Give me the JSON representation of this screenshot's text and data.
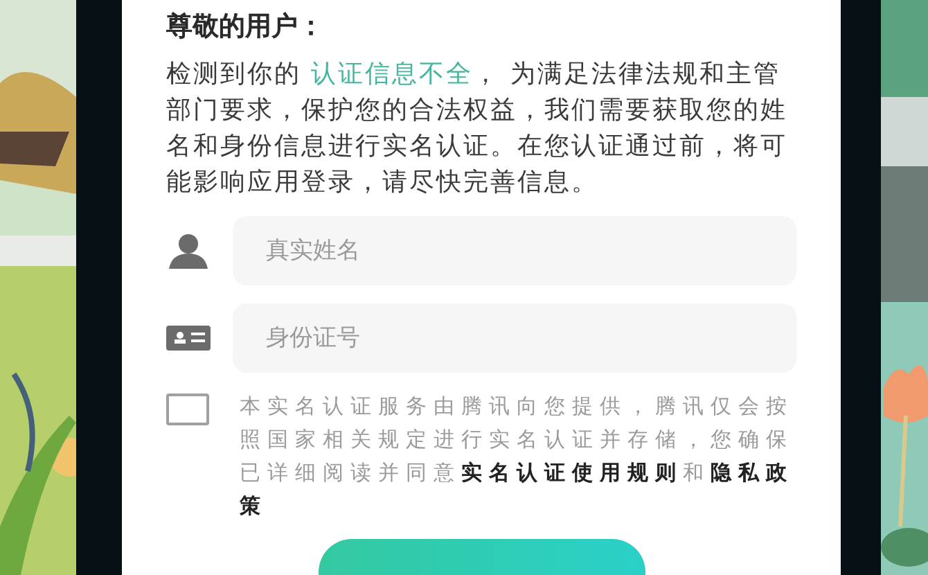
{
  "greeting": "尊敬的用户：",
  "notice": [
    {
      "kind": "plain",
      "text": "检测到你的 "
    },
    {
      "kind": "link",
      "text": "认证信息不全"
    },
    {
      "kind": "plain",
      "text": "， 为满足法律法规和主管部门要求，保护您的合法权益，我们需要获取您的姓名和身份信息进行实名认证。在您认证通过前，将可能影响应用登录，请尽快完善信息。"
    }
  ],
  "fields": [
    {
      "kind": "name",
      "placeholder": "真实姓名"
    },
    {
      "kind": "id",
      "placeholder": "身份证号"
    }
  ],
  "consent": {
    "checked": false,
    "text": "本实名认证服务由腾讯向您提供，腾讯仅会按照国家相关规定进行实名认证并存储，您确保已详细阅读并同意**实名认证使用规则**和**隐私政策**"
  }
}
